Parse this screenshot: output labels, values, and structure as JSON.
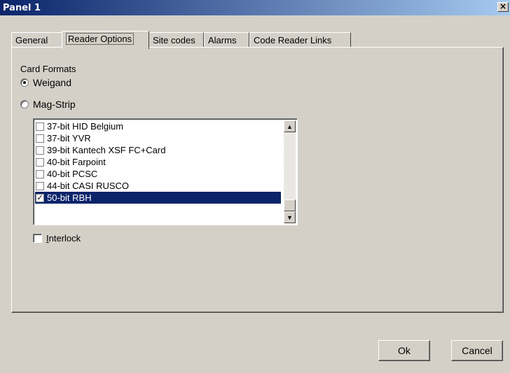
{
  "window": {
    "title": "Panel 1",
    "close_glyph": "×"
  },
  "tabs": [
    {
      "label": "General",
      "active": false
    },
    {
      "label": "Reader Options",
      "active": true
    },
    {
      "label": "Site codes",
      "active": false
    },
    {
      "label": "Alarms",
      "active": false
    },
    {
      "label": "Code Reader Links",
      "active": false
    }
  ],
  "card_formats": {
    "label": "Card Formats",
    "options": [
      {
        "label": "Weigand",
        "checked": true
      },
      {
        "label": "Mag-Strip",
        "checked": false
      }
    ]
  },
  "format_list": {
    "items": [
      {
        "label": "37-bit HID Belgium",
        "checked": false,
        "selected": false
      },
      {
        "label": "37-bit YVR",
        "checked": false,
        "selected": false
      },
      {
        "label": "39-bit Kantech XSF FC+Card",
        "checked": false,
        "selected": false
      },
      {
        "label": "40-bit Farpoint",
        "checked": false,
        "selected": false
      },
      {
        "label": "40-bit PCSC",
        "checked": false,
        "selected": false
      },
      {
        "label": "44-bit CASI RUSCO",
        "checked": false,
        "selected": false
      },
      {
        "label": "50-bit RBH",
        "checked": true,
        "selected": true
      }
    ]
  },
  "interlock": {
    "label_first": "I",
    "label_rest": "nterlock",
    "checked": false
  },
  "buttons": {
    "ok": "Ok",
    "cancel": "Cancel"
  },
  "colors": {
    "face": "#d4d0c8",
    "selection": "#0a246a",
    "title_start": "#0a246a",
    "title_end": "#a6caf0"
  },
  "icons": {
    "close": "close-icon",
    "scroll_up": "scroll-up-icon",
    "scroll_down": "scroll-down-icon"
  }
}
